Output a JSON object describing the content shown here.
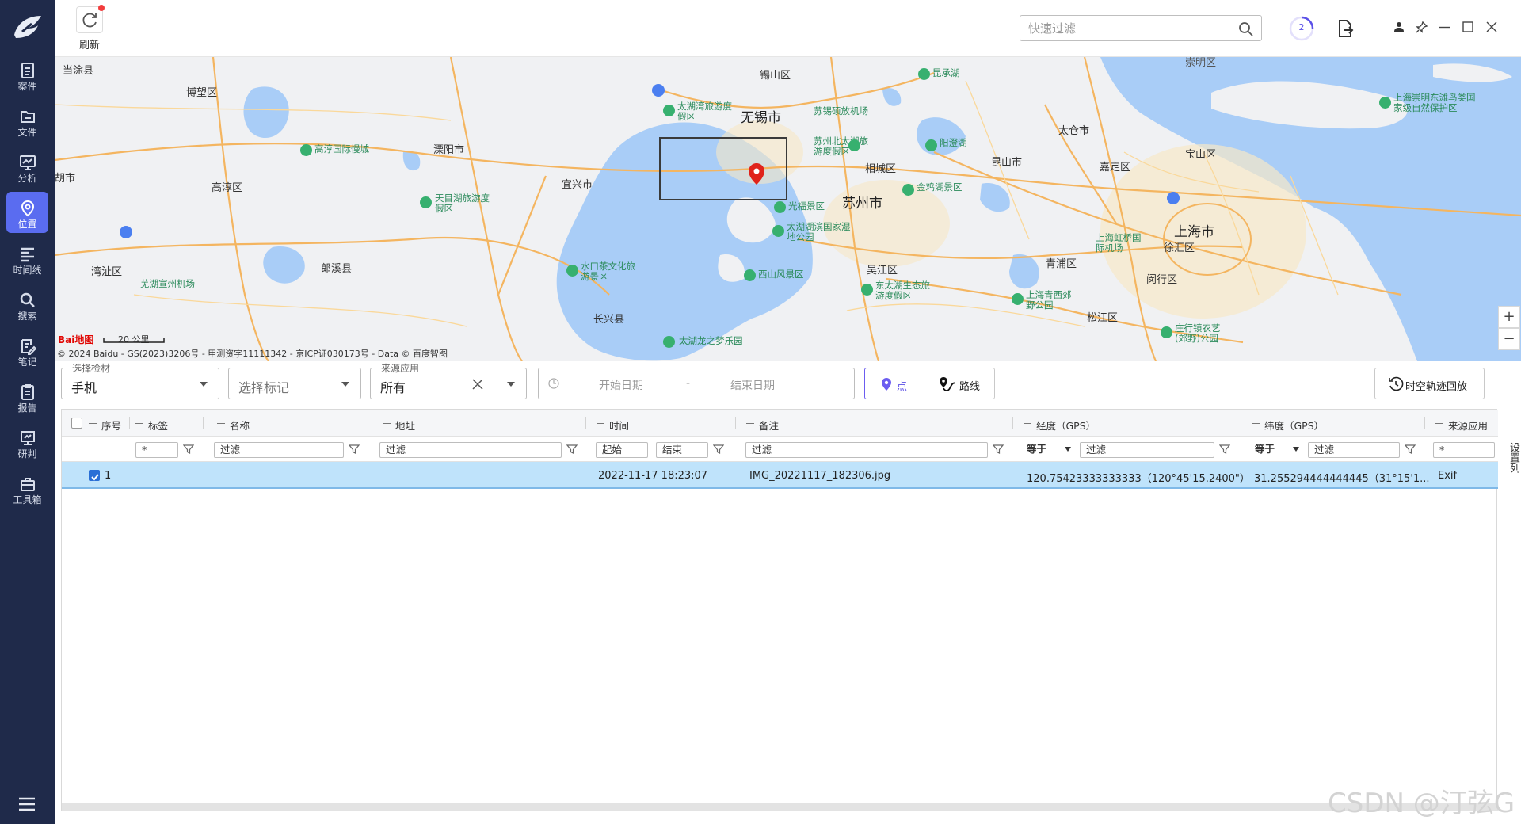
{
  "sidebar": {
    "items": [
      {
        "label": "案件",
        "icon": "case-icon"
      },
      {
        "label": "文件",
        "icon": "folder-icon"
      },
      {
        "label": "分析",
        "icon": "analysis-icon"
      },
      {
        "label": "位置",
        "icon": "location-icon",
        "active": true
      },
      {
        "label": "时间线",
        "icon": "timeline-icon"
      },
      {
        "label": "搜索",
        "icon": "search-icon"
      },
      {
        "label": "笔记",
        "icon": "note-icon"
      },
      {
        "label": "报告",
        "icon": "report-icon"
      },
      {
        "label": "研判",
        "icon": "judge-icon"
      },
      {
        "label": "工具箱",
        "icon": "toolbox-icon"
      }
    ],
    "accent": "#5a6cf0",
    "background": "#1f2a4a"
  },
  "toolbar": {
    "refresh_label": "刷新",
    "search_placeholder": "快速过滤",
    "task_count": "2"
  },
  "map": {
    "labels": {
      "dangtu": "当涂县",
      "bowang": "博望区",
      "xishan": "锡山区",
      "wuxi": "无锡市",
      "shuofang": "苏锡硕放机场",
      "kunchenghu": "昆承湖",
      "yangcheng": "阳澄湖",
      "taicang": "太仓市",
      "chongming": "上海崇明东滩鸟类国家级自然保护区",
      "gaochun_city": "高淳国际慢城",
      "liyang": "溧阳市",
      "yixing": "宜兴市",
      "xiangcheng": "相城区",
      "kunshan": "昆山市",
      "jiading": "嘉定区",
      "baoshan": "宝山区",
      "hushi": "胡市",
      "gaochun": "高淳区",
      "tianmuhu": "天目湖旅游度假区",
      "guangfu": "光福景区",
      "suzhou": "苏州市",
      "jinjihu": "金鸡湖景区",
      "taihubeihu": "苏州北太湖旅游度假区",
      "taihuwetland": "太湖湖滨国家湿地公园",
      "taihuwan": "太湖湾旅游度假区",
      "hongqiao": "上海虹桥国际机场",
      "shanghai": "上海市",
      "xuhui": "徐汇区",
      "wanzhi": "湾沚区",
      "langxi": "郎溪县",
      "wuhu_airport": "芜湖宣州机场",
      "shuikou": "水口茶文化旅游景区",
      "xishan_scenic": "西山风景区",
      "wujiang": "吴江区",
      "qingpu": "青浦区",
      "minhang": "闵行区",
      "dongtaihu": "东太湖生态旅游度假区",
      "qingxi": "上海青西郊野公园",
      "songjiang": "松江区",
      "changxing": "长兴县",
      "zhuangxing": "庄行镇农艺(郊野)公园",
      "longzhimeng": "太湖龙之梦乐园"
    },
    "copyright": "© 2024 Baidu - GS(2023)3206号 - 甲测资字11111342 - 京ICP证030173号 - Data © 百度智图",
    "scale": "20 公里",
    "baidu_logo": "Bai地图",
    "zoom_in": "+",
    "zoom_out": "−",
    "top_partial": "崇明区"
  },
  "filters": {
    "evidence": {
      "caption": "选择检材",
      "value": "手机"
    },
    "marker": {
      "placeholder": "选择标记"
    },
    "source": {
      "caption": "来源应用",
      "value": "所有"
    },
    "date": {
      "start": "开始日期",
      "sep": "-",
      "end": "结束日期"
    },
    "mode_point": "点",
    "mode_route": "路线",
    "playback": "时空轨迹回放"
  },
  "table": {
    "columns": [
      {
        "label": "序号"
      },
      {
        "label": "标签"
      },
      {
        "label": "名称"
      },
      {
        "label": "地址"
      },
      {
        "label": "时间"
      },
      {
        "label": "备注"
      },
      {
        "label": "经度（GPS）"
      },
      {
        "label": "纬度（GPS）"
      },
      {
        "label": "来源应用"
      }
    ],
    "filters": {
      "seq": "*",
      "tag": "过滤",
      "name": "过滤",
      "addr": "过滤",
      "time_start": "起始",
      "time_end": "结束",
      "remark": "过滤",
      "lng_op": "等于",
      "lng": "过滤",
      "lat_op": "等于",
      "lat": "过滤",
      "source": "*"
    },
    "rows": [
      {
        "seq": "1",
        "time": "2022-11-17 18:23:07",
        "remark": "IMG_20221117_182306.jpg",
        "lng": "120.75423333333333（120°45'15.2400\"）",
        "lat": "31.255294444444445（31°15'1...",
        "source": "Exif"
      }
    ],
    "settings_label": "设置列"
  },
  "watermark": "CSDN @汀弦G"
}
